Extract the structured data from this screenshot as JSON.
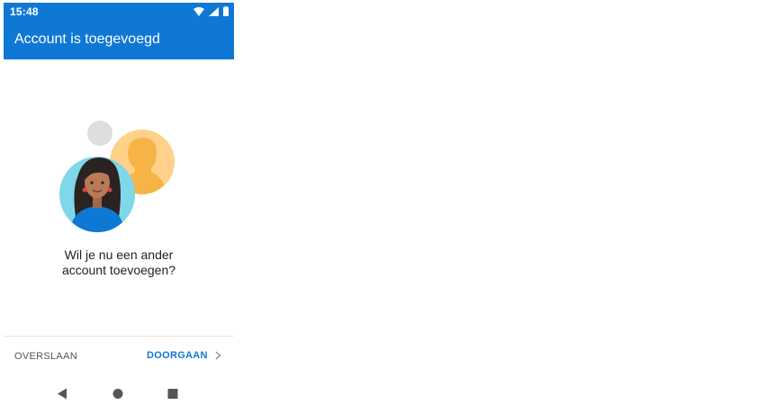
{
  "status_bar": {
    "time": "15:48",
    "icons": [
      "wifi-icon",
      "signal-icon",
      "battery-icon"
    ]
  },
  "header": {
    "title": "Account is toegevoegd"
  },
  "illustration": {
    "icons": [
      "placeholder-avatar-icon",
      "person-silhouette-icon",
      "woman-avatar-icon"
    ]
  },
  "main": {
    "question_line1": "Wil je nu een ander",
    "question_line2": "account toevoegen?"
  },
  "footer": {
    "skip_label": "OVERSLAAN",
    "continue_label": "DOORGAAN"
  },
  "nav_bar": {
    "icons": [
      "back-icon",
      "home-icon",
      "recents-icon"
    ]
  },
  "colors": {
    "accent": "#0f78d4",
    "avatar_bg": "#7fd7ea",
    "silhouette_bg": "#ffd18a"
  }
}
